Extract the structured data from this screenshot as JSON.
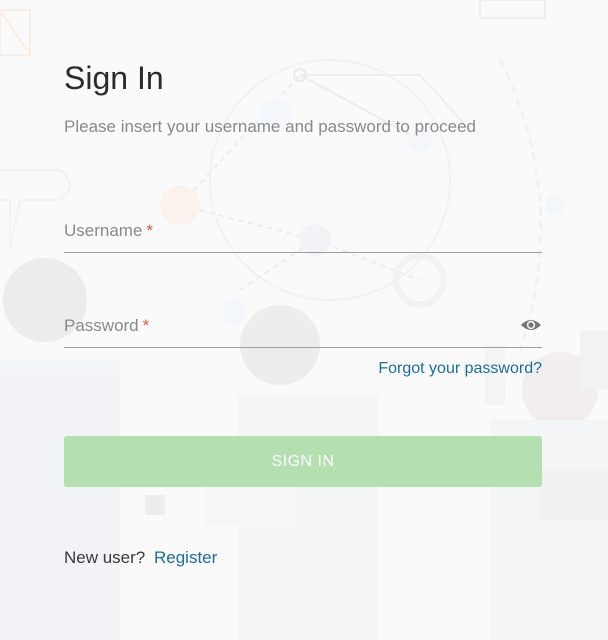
{
  "form": {
    "title": "Sign In",
    "subtitle": "Please insert your username and password to proceed",
    "username_label": "Username",
    "password_label": "Password",
    "required_marker": "*",
    "forgot_link": "Forgot your password?",
    "signin_button": "SIGN IN",
    "new_user_text": "New user?",
    "register_link": "Register"
  },
  "colors": {
    "link": "#1f6c9e",
    "button_bg": "#b3dfb1",
    "required": "#d9534f"
  }
}
